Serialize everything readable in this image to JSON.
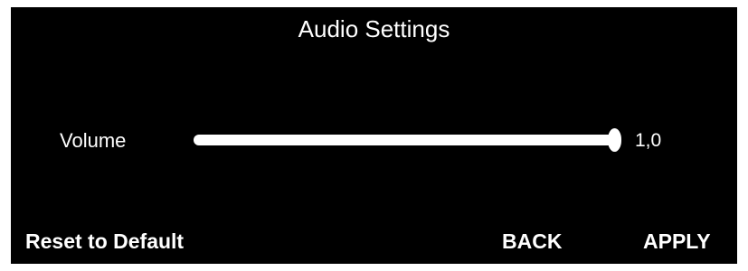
{
  "header": {
    "title": "Audio Settings"
  },
  "volume": {
    "label": "Volume",
    "value_text": "1,0",
    "level_fraction": 1.0
  },
  "buttons": {
    "reset_label": "Reset to Default",
    "back_label": "BACK",
    "apply_label": "APPLY"
  },
  "colors": {
    "background": "#000000",
    "foreground": "#ffffff"
  }
}
